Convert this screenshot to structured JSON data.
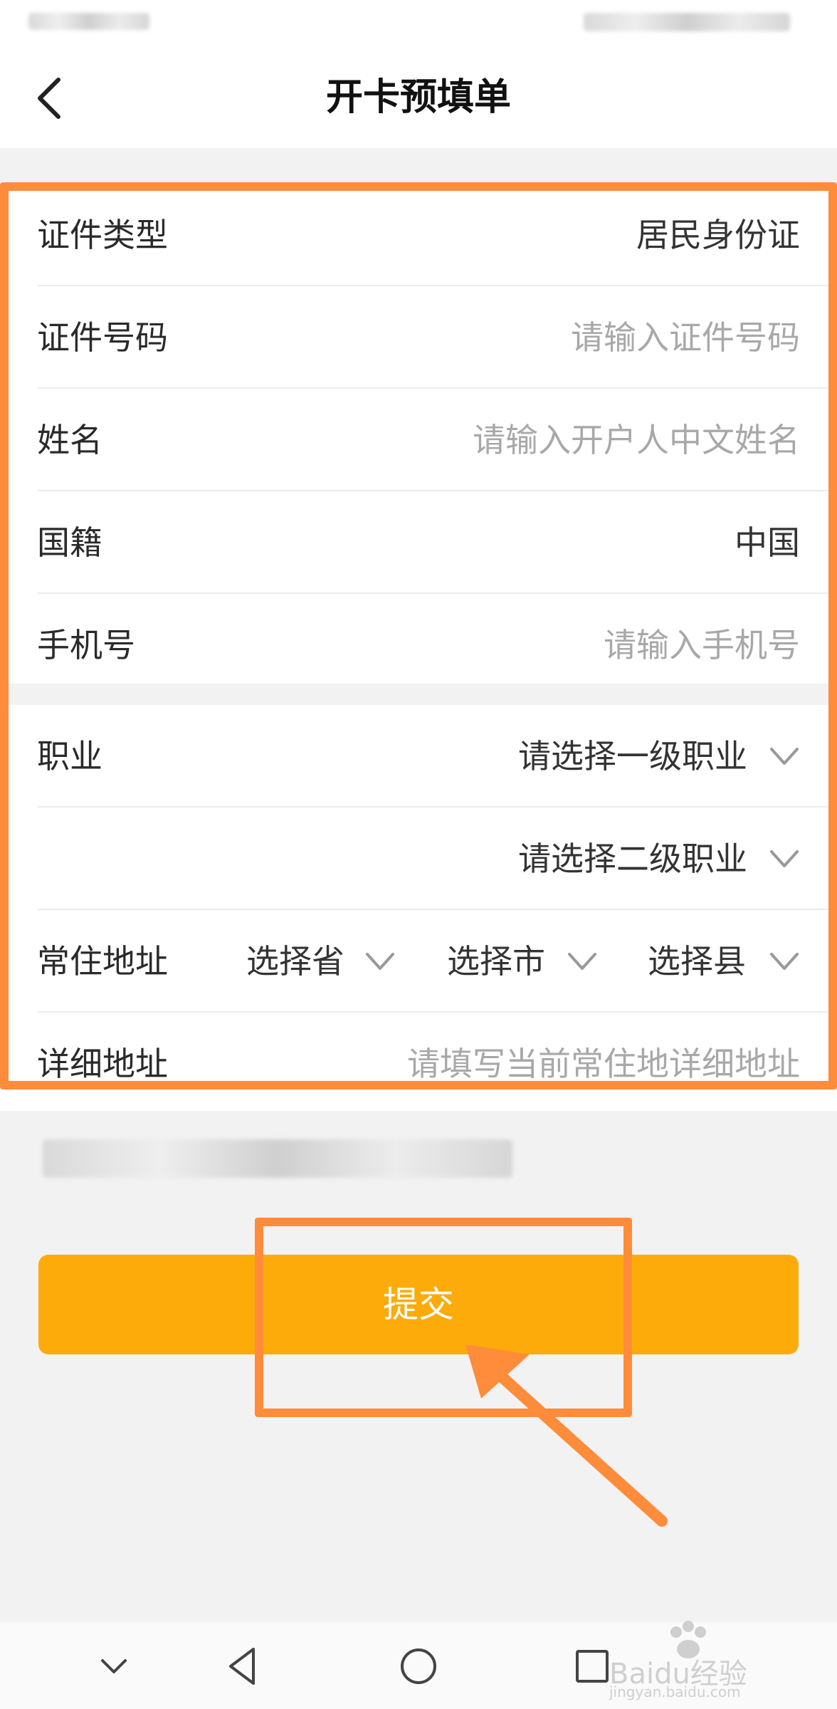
{
  "header": {
    "title": "开卡预填单",
    "back_icon": "chevron-left-icon"
  },
  "form": {
    "id_type": {
      "label": "证件类型",
      "value": "居民身份证"
    },
    "id_number": {
      "label": "证件号码",
      "placeholder": "请输入证件号码"
    },
    "name": {
      "label": "姓名",
      "placeholder": "请输入开户人中文姓名"
    },
    "nationality": {
      "label": "国籍",
      "value": "中国"
    },
    "phone": {
      "label": "手机号",
      "placeholder": "请输入手机号"
    },
    "occupation": {
      "label": "职业",
      "level1_placeholder": "请选择一级职业",
      "level2_placeholder": "请选择二级职业"
    },
    "address": {
      "label": "常住地址",
      "province": "选择省",
      "city": "选择市",
      "county": "选择县"
    },
    "detail_address": {
      "label": "详细地址",
      "placeholder": "请填写当前常住地详细地址"
    }
  },
  "submit_label": "提交",
  "colors": {
    "accent": "#fcab0a",
    "annotation": "#ff8c3a",
    "placeholder": "#a8a8a8"
  },
  "watermark": {
    "text": "Baidu经验",
    "subtext": "jingyan.baidu.com"
  }
}
